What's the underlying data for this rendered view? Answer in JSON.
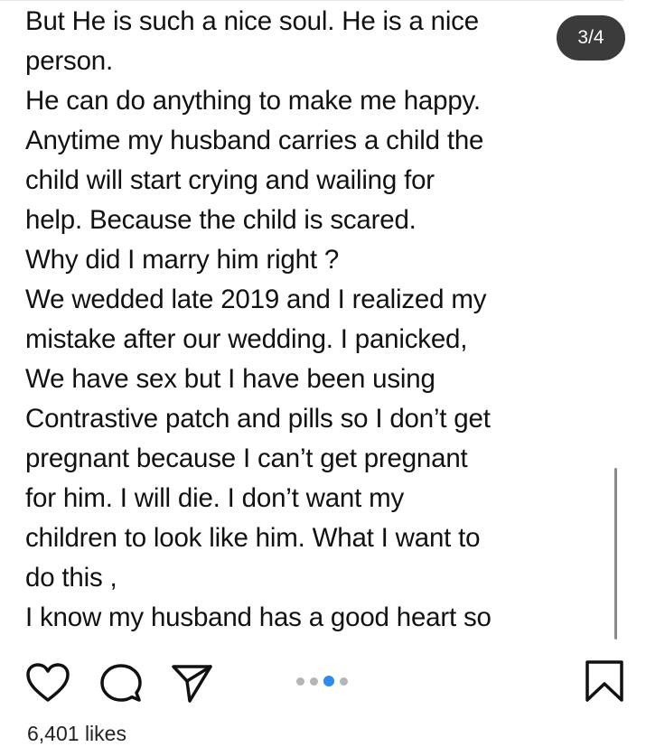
{
  "post": {
    "lines": [
      "But He is such a nice soul. He is a nice",
      "person.",
      "He can do anything to make me happy.",
      "Anytime my husband carries a child the",
      "child will start crying and wailing for",
      "help. Because the child is scared.",
      "Why did I marry him right ?",
      "We wedded late 2019 and  I realized my",
      "mistake after our wedding. I panicked,",
      "We have sex but I have been using",
      "Contrastive patch and pills so I don’t get",
      "pregnant because I can’t get pregnant",
      "for him. I will die. I don’t want my",
      "children to look like him. What I want to",
      "do this ,",
      "I know my husband has a good heart so"
    ]
  },
  "carousel": {
    "counter": "3/4",
    "current_slide": 3,
    "total_slides": 4,
    "active_dot_color": "#2d8cf0"
  },
  "actions": {
    "icons": [
      "heart-icon",
      "comment-icon",
      "share-icon",
      "bookmark-icon"
    ]
  },
  "likes": {
    "text": "6,401 likes"
  }
}
